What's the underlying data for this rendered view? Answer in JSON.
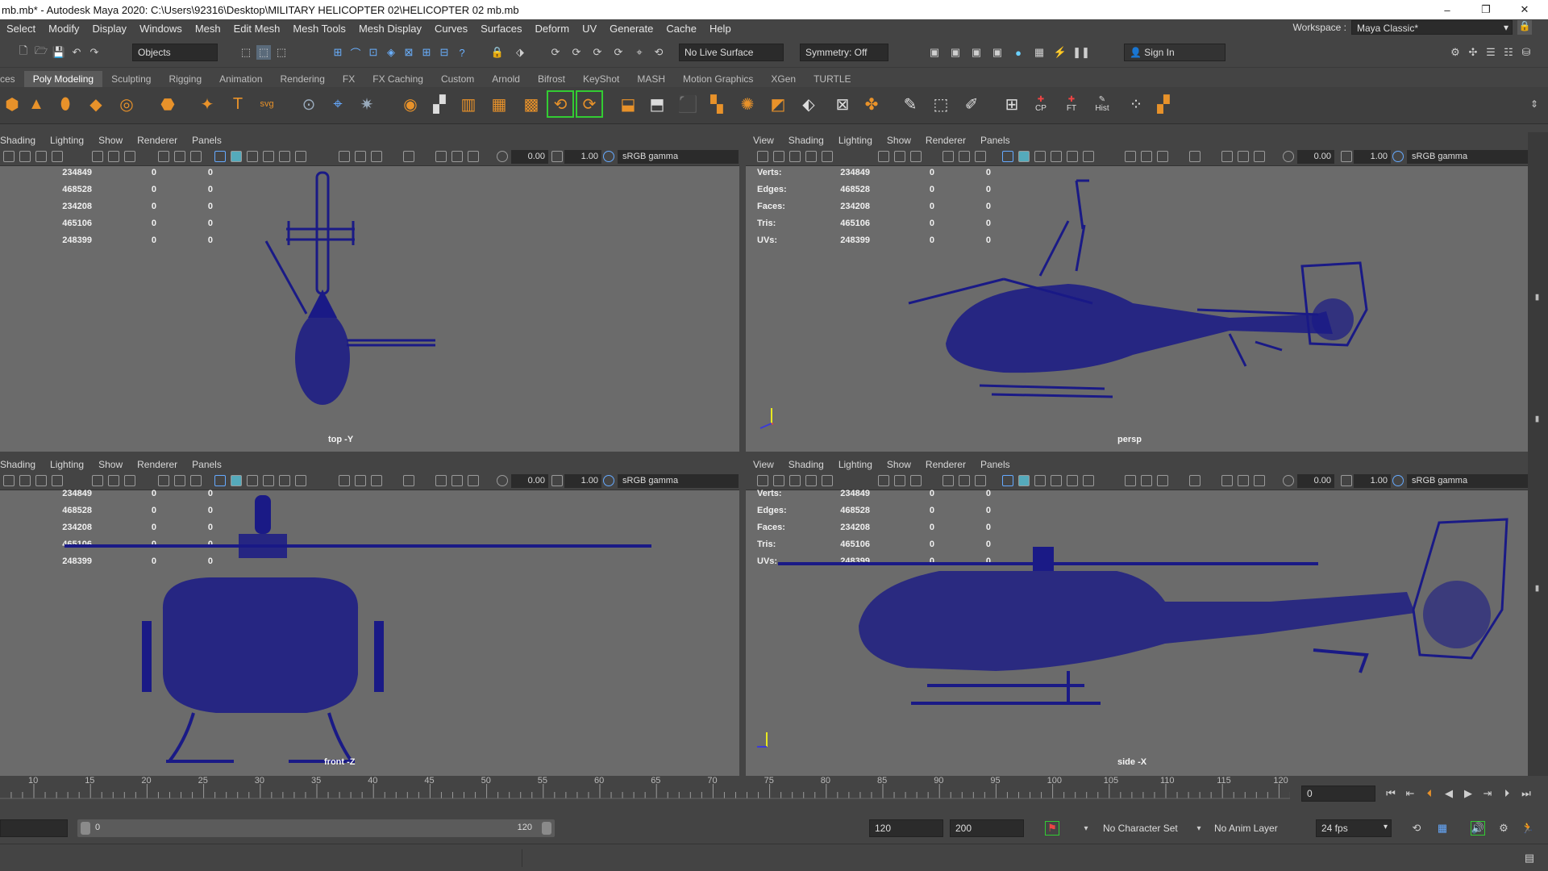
{
  "window": {
    "title": "mb.mb* - Autodesk Maya 2020: C:\\Users\\92316\\Desktop\\MILITARY HELICOPTER 02\\HELICOPTER 02 mb.mb",
    "minimize": "–",
    "restore": "❐",
    "close": "✕"
  },
  "menus": [
    "Select",
    "Modify",
    "Display",
    "Windows",
    "Mesh",
    "Edit Mesh",
    "Mesh Tools",
    "Mesh Display",
    "Curves",
    "Surfaces",
    "Deform",
    "UV",
    "Generate",
    "Cache",
    "Help"
  ],
  "workspace": {
    "label": "Workspace :",
    "value": "Maya Classic*"
  },
  "statusline": {
    "mode": "Objects",
    "live_surface": "No Live Surface",
    "symmetry": "Symmetry: Off",
    "sign_in": "Sign In"
  },
  "shelf_tabs": [
    "ces",
    "Poly Modeling",
    "Sculpting",
    "Rigging",
    "Animation",
    "Rendering",
    "FX",
    "FX Caching",
    "Custom",
    "Arnold",
    "Bifrost",
    "KeyShot",
    "MASH",
    "Motion Graphics",
    "XGen",
    "TURTLE"
  ],
  "shelf_labels": {
    "cp": "CP",
    "ft": "FT",
    "hist": "Hist"
  },
  "panel_menus": [
    "View",
    "Shading",
    "Lighting",
    "Show",
    "Renderer",
    "Panels"
  ],
  "panel_menus_short": [
    "Shading",
    "Lighting",
    "Show",
    "Renderer",
    "Panels"
  ],
  "toolbar": {
    "exposure": "0.00",
    "gamma": "1.00",
    "colorspace": "sRGB gamma"
  },
  "hud": {
    "labels": [
      "Verts:",
      "Edges:",
      "Faces:",
      "Tris:",
      "UVs:"
    ],
    "values": [
      "234849",
      "468528",
      "234208",
      "465106",
      "248399"
    ],
    "zero": "0"
  },
  "viewports": {
    "top": "top -Y",
    "persp": "persp",
    "front": "front -Z",
    "side": "side -X"
  },
  "timeline": {
    "ticks": [
      "10",
      "15",
      "20",
      "25",
      "30",
      "35",
      "40",
      "45",
      "50",
      "55",
      "60",
      "65",
      "70",
      "75",
      "80",
      "85",
      "90",
      "95",
      "100",
      "105",
      "110",
      "115",
      "120"
    ],
    "current_frame": "0"
  },
  "range": {
    "start": "0",
    "end": "120",
    "anim_end": "120",
    "total_end": "200",
    "character_set": "No Character Set",
    "anim_layer": "No Anim Layer",
    "fps": "24 fps"
  },
  "colors": {
    "wire": "#1a1a86",
    "viewport_bg": "#6b6b6b",
    "ui": "#444444"
  }
}
